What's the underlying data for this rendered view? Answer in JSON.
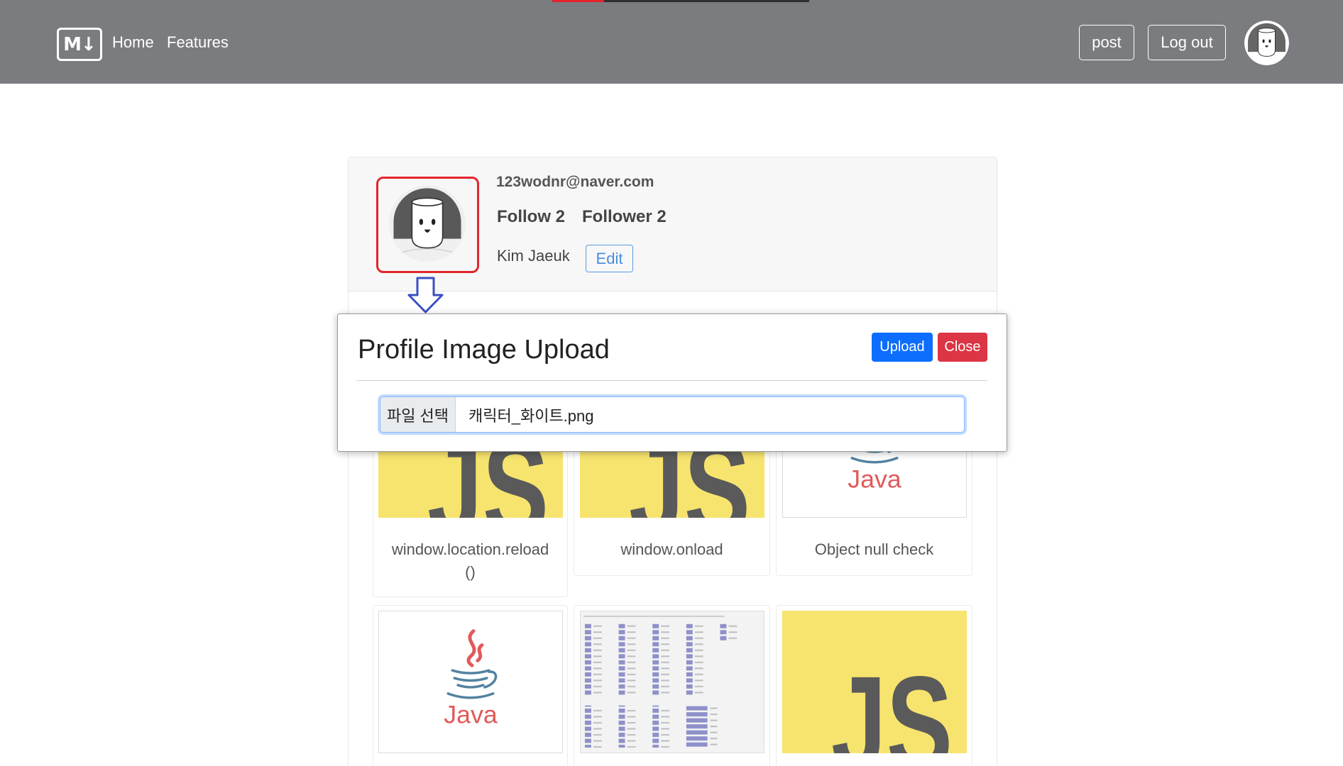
{
  "navbar": {
    "links": [
      {
        "label": "Home"
      },
      {
        "label": "Features"
      }
    ],
    "post_label": "post",
    "logout_label": "Log out",
    "avatar_icon": "user-avatar-icon"
  },
  "logos": {
    "brand": "M↓",
    "js": "JS",
    "java": "Java"
  },
  "profile": {
    "email": "123wodnr@naver.com",
    "follow_label": "Follow",
    "follow_count": "2",
    "follower_label": "Follower",
    "follower_count": "2",
    "name": "Kim Jaeuk",
    "edit_label": "Edit",
    "avatar_icon": "profile-avatar-image"
  },
  "annotation": {
    "frame_icon": "highlight-frame",
    "arrow_icon": "down-arrow-icon"
  },
  "modal": {
    "title": "Profile Image Upload",
    "upload_label": "Upload",
    "close_label": "Close",
    "file_button_label": "파일 선택",
    "file_value": "캐릭터_화이트.png"
  },
  "posts": [
    {
      "title": "window.location.reload ()",
      "thumbnail": "javascript-logo"
    },
    {
      "title": "window.onload",
      "thumbnail": "javascript-logo"
    },
    {
      "title": "Object null check",
      "thumbnail": "java-logo"
    },
    {
      "thumbnail": "java-logo"
    },
    {
      "thumbnail": "keycode-table"
    },
    {
      "thumbnail": "javascript-logo"
    }
  ],
  "colors": {
    "navbar_bg": "#7b7c80",
    "highlight_frame": "#e3262e",
    "arrow": "#3a4fc4",
    "upload_button": "#0d6efd",
    "close_button": "#dc3545",
    "edit_button": "#4a8fe0",
    "js_yellow": "#f7e46e",
    "java_red": "#e15a5a",
    "java_blue": "#5382a1"
  }
}
